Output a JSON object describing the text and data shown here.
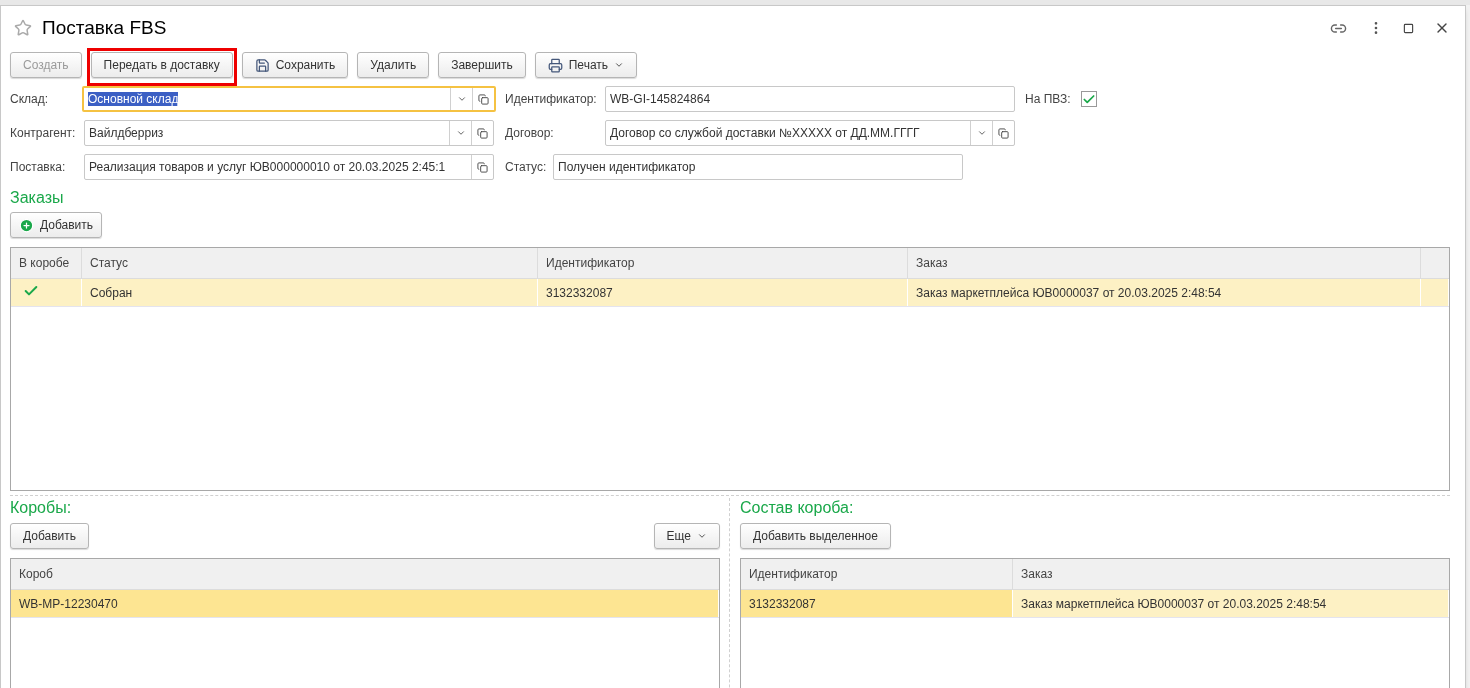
{
  "window": {
    "title": "Поставка FBS",
    "favorite": false
  },
  "toolbar": [
    {
      "kind": "button",
      "label": "Создать",
      "disabled": true,
      "highlighted": false
    },
    {
      "kind": "button",
      "label": "Передать в доставку",
      "disabled": false,
      "highlighted": true
    },
    {
      "kind": "save",
      "label": "Сохранить",
      "disabled": false,
      "highlighted": false
    },
    {
      "kind": "button",
      "label": "Удалить",
      "disabled": false,
      "highlighted": false
    },
    {
      "kind": "button",
      "label": "Завершить",
      "disabled": false,
      "highlighted": false
    },
    {
      "kind": "print",
      "label": "Печать",
      "disabled": false,
      "highlighted": false
    }
  ],
  "fields": {
    "warehouse": {
      "label": "Склад:",
      "value": "Основной склад",
      "focused": true
    },
    "identifier": {
      "label": "Идентификатор:",
      "value": "WB-GI-145824864"
    },
    "pvz": {
      "label": "На ПВЗ:",
      "checked": true
    },
    "counterparty": {
      "label": "Контрагент:",
      "value": "Вайлдберриз"
    },
    "contract": {
      "label": "Договор:",
      "value": "Договор со службой доставки №XXXXX от ДД.ММ.ГГГГ"
    },
    "supply": {
      "label": "Поставка:",
      "value": "Реализация товаров и услуг ЮВ000000010 от 20.03.2025 2:45:1"
    },
    "status": {
      "label": "Статус:",
      "value": "Получен идентификатор"
    }
  },
  "orders": {
    "title": "Заказы",
    "add_button": "Добавить",
    "columns": [
      "В коробе",
      "Статус",
      "Идентификатор",
      "Заказ"
    ],
    "rows": [
      {
        "in_box": true,
        "status": "Собран",
        "identifier": "3132332087",
        "order": "Заказ маркетплейса ЮВ0000037 от 20.03.2025 2:48:54",
        "selected": true
      }
    ]
  },
  "boxes": {
    "title": "Коробы:",
    "add_button": "Добавить",
    "more_button": "Еще",
    "columns": [
      "Короб"
    ],
    "rows": [
      {
        "box": "WB-MP-12230470",
        "selected": true
      }
    ]
  },
  "box_contents": {
    "title": "Состав короба:",
    "add_button": "Добавить выделенное",
    "columns": [
      "Идентификатор",
      "Заказ"
    ],
    "rows": [
      {
        "identifier": "3132332087",
        "order": "Заказ маркетплейса ЮВ0000037 от 20.03.2025 2:48:54",
        "selected": true
      }
    ]
  }
}
